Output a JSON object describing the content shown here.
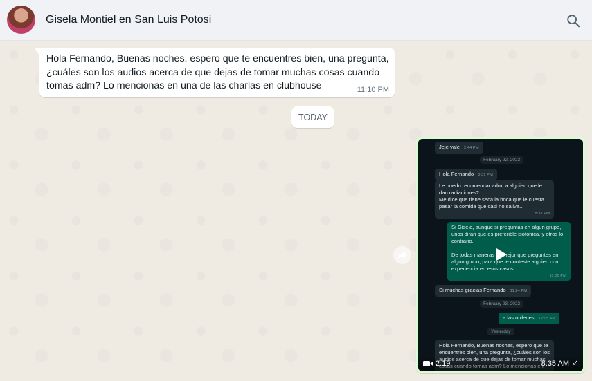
{
  "header": {
    "contact_name": "Gisela Montiel en San Luis Potosi",
    "avatar_icon": "profile-photo",
    "search_icon": "search-icon"
  },
  "messages": {
    "incoming": {
      "text": "Hola Fernando, Buenas noches, espero que te encuentres bien, una pregunta, ¿cuáles son los audios acerca de que dejas de tomar muchas cosas cuando tomas adm? Lo mencionas en una de las charlas en clubhouse",
      "time": "11:10 PM"
    },
    "date_divider": "TODAY",
    "video": {
      "duration": "2:19",
      "time": "8:35 AM",
      "status": "✓",
      "preview": {
        "m1": "Jeje vale",
        "m1_time": "2:44 PM",
        "date1": "February 22, 2023",
        "m2": "Hola Fernando",
        "m2_time": "8:31 PM",
        "m3": "Le puedo recomendar adm,  a alguien que le dan radiaciones?\n Me dice que tiene seca la boca que le cuesta pasar la comida que casi no saliva...",
        "m3_time": "8:31 PM",
        "m4": "Si Gisela, aunque si preguntas en algun grupo, unos diran que es preferible isotonica, y otros lo contrario.\n\nDe todas maneras es mejor que preguntes en algun grupo, para que te conteste alguien con experiencia en esos casos.",
        "m4_time": "11:06 PM",
        "m5": "Si muchas gracias Fernando",
        "m5_time": "11:24 PM",
        "date2": "February 23, 2023",
        "m6": "a las ordenes",
        "m6_time": "12:05 AM",
        "date3": "Yesterday",
        "m7": "Hola Fernando, Buenas noches, espero que te encuentres bien, una pregunta, ¿cuáles son los audios acerca de que dejas de tomar muchas cosas cuando tomas adm? Lo mencionas en una de las charlas en"
      }
    }
  },
  "colors": {
    "header_bg": "#f0f2f5",
    "chat_bg": "#efeae2",
    "incoming_bubble": "#ffffff",
    "outgoing_bubble": "#d9fdd3"
  }
}
